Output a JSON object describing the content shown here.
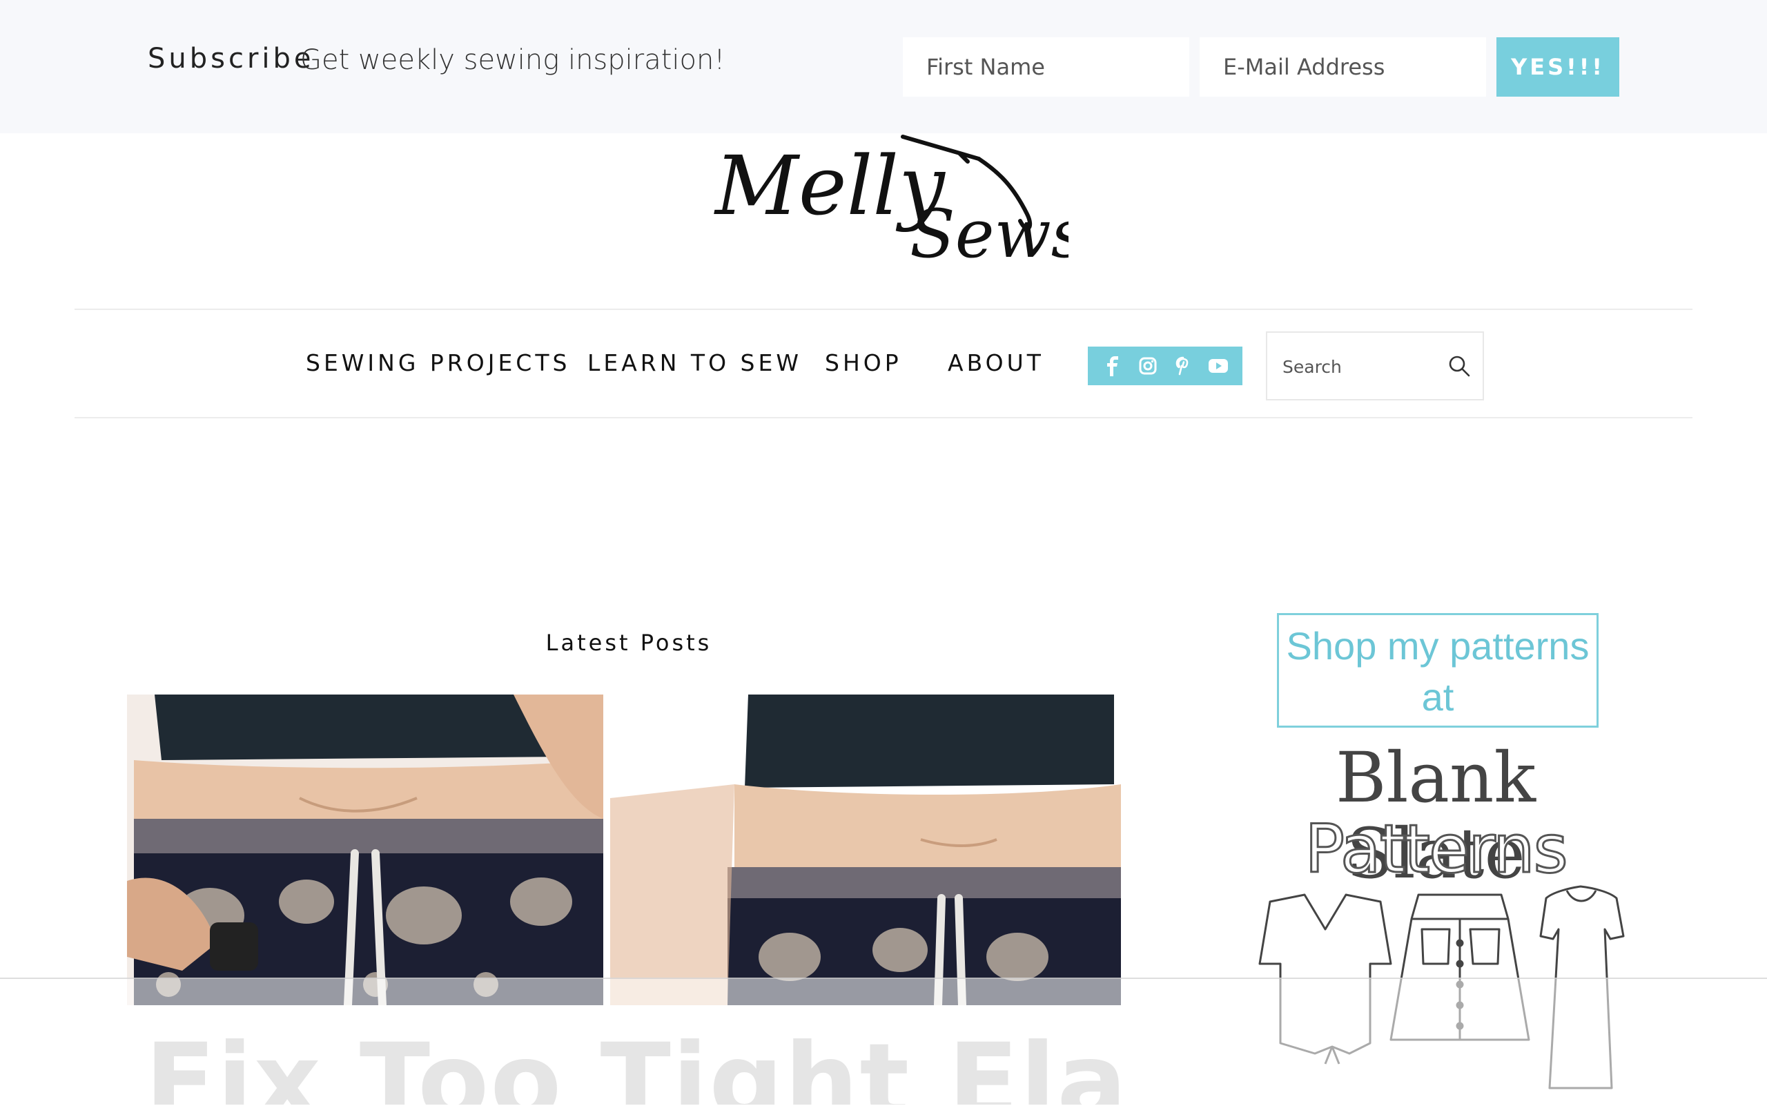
{
  "subscribe": {
    "heading": "Subscribe",
    "tagline": "Get weekly sewing inspiration!",
    "first_name_placeholder": "First Name",
    "email_placeholder": "E-Mail Address",
    "button_label": "YES!!!"
  },
  "logo": {
    "text_top": "Melly",
    "text_bottom": "Sews"
  },
  "nav": {
    "items": [
      {
        "label": "SEWING PROJECTS"
      },
      {
        "label": "LEARN TO SEW"
      },
      {
        "label": "SHOP"
      },
      {
        "label": "ABOUT"
      }
    ],
    "social_icons": [
      "facebook-icon",
      "instagram-icon",
      "pinterest-icon",
      "youtube-icon"
    ],
    "search_placeholder": "Search"
  },
  "main": {
    "section_title": "Latest Posts",
    "post_title": "Fix Too Tight Elastic"
  },
  "sidebar": {
    "shop_text_line1": "Shop my patterns",
    "shop_text_line2": "at",
    "brand_line1": "Blank Slate",
    "brand_line2": "Patterns"
  },
  "colors": {
    "accent": "#78cfdd",
    "subscribe_bg": "#f7f8fb"
  }
}
